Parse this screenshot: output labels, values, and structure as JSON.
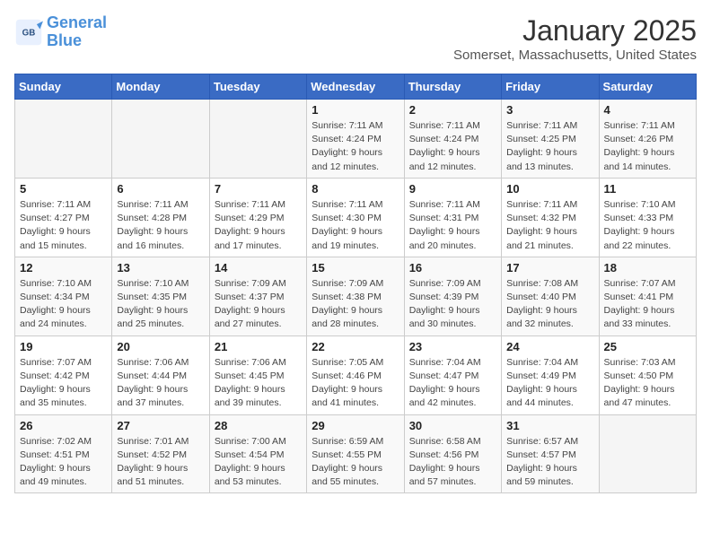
{
  "header": {
    "logo_line1": "General",
    "logo_line2": "Blue",
    "month_title": "January 2025",
    "location": "Somerset, Massachusetts, United States"
  },
  "weekdays": [
    "Sunday",
    "Monday",
    "Tuesday",
    "Wednesday",
    "Thursday",
    "Friday",
    "Saturday"
  ],
  "weeks": [
    [
      {
        "day": "",
        "info": ""
      },
      {
        "day": "",
        "info": ""
      },
      {
        "day": "",
        "info": ""
      },
      {
        "day": "1",
        "info": "Sunrise: 7:11 AM\nSunset: 4:24 PM\nDaylight: 9 hours\nand 12 minutes."
      },
      {
        "day": "2",
        "info": "Sunrise: 7:11 AM\nSunset: 4:24 PM\nDaylight: 9 hours\nand 12 minutes."
      },
      {
        "day": "3",
        "info": "Sunrise: 7:11 AM\nSunset: 4:25 PM\nDaylight: 9 hours\nand 13 minutes."
      },
      {
        "day": "4",
        "info": "Sunrise: 7:11 AM\nSunset: 4:26 PM\nDaylight: 9 hours\nand 14 minutes."
      }
    ],
    [
      {
        "day": "5",
        "info": "Sunrise: 7:11 AM\nSunset: 4:27 PM\nDaylight: 9 hours\nand 15 minutes."
      },
      {
        "day": "6",
        "info": "Sunrise: 7:11 AM\nSunset: 4:28 PM\nDaylight: 9 hours\nand 16 minutes."
      },
      {
        "day": "7",
        "info": "Sunrise: 7:11 AM\nSunset: 4:29 PM\nDaylight: 9 hours\nand 17 minutes."
      },
      {
        "day": "8",
        "info": "Sunrise: 7:11 AM\nSunset: 4:30 PM\nDaylight: 9 hours\nand 19 minutes."
      },
      {
        "day": "9",
        "info": "Sunrise: 7:11 AM\nSunset: 4:31 PM\nDaylight: 9 hours\nand 20 minutes."
      },
      {
        "day": "10",
        "info": "Sunrise: 7:11 AM\nSunset: 4:32 PM\nDaylight: 9 hours\nand 21 minutes."
      },
      {
        "day": "11",
        "info": "Sunrise: 7:10 AM\nSunset: 4:33 PM\nDaylight: 9 hours\nand 22 minutes."
      }
    ],
    [
      {
        "day": "12",
        "info": "Sunrise: 7:10 AM\nSunset: 4:34 PM\nDaylight: 9 hours\nand 24 minutes."
      },
      {
        "day": "13",
        "info": "Sunrise: 7:10 AM\nSunset: 4:35 PM\nDaylight: 9 hours\nand 25 minutes."
      },
      {
        "day": "14",
        "info": "Sunrise: 7:09 AM\nSunset: 4:37 PM\nDaylight: 9 hours\nand 27 minutes."
      },
      {
        "day": "15",
        "info": "Sunrise: 7:09 AM\nSunset: 4:38 PM\nDaylight: 9 hours\nand 28 minutes."
      },
      {
        "day": "16",
        "info": "Sunrise: 7:09 AM\nSunset: 4:39 PM\nDaylight: 9 hours\nand 30 minutes."
      },
      {
        "day": "17",
        "info": "Sunrise: 7:08 AM\nSunset: 4:40 PM\nDaylight: 9 hours\nand 32 minutes."
      },
      {
        "day": "18",
        "info": "Sunrise: 7:07 AM\nSunset: 4:41 PM\nDaylight: 9 hours\nand 33 minutes."
      }
    ],
    [
      {
        "day": "19",
        "info": "Sunrise: 7:07 AM\nSunset: 4:42 PM\nDaylight: 9 hours\nand 35 minutes."
      },
      {
        "day": "20",
        "info": "Sunrise: 7:06 AM\nSunset: 4:44 PM\nDaylight: 9 hours\nand 37 minutes."
      },
      {
        "day": "21",
        "info": "Sunrise: 7:06 AM\nSunset: 4:45 PM\nDaylight: 9 hours\nand 39 minutes."
      },
      {
        "day": "22",
        "info": "Sunrise: 7:05 AM\nSunset: 4:46 PM\nDaylight: 9 hours\nand 41 minutes."
      },
      {
        "day": "23",
        "info": "Sunrise: 7:04 AM\nSunset: 4:47 PM\nDaylight: 9 hours\nand 42 minutes."
      },
      {
        "day": "24",
        "info": "Sunrise: 7:04 AM\nSunset: 4:49 PM\nDaylight: 9 hours\nand 44 minutes."
      },
      {
        "day": "25",
        "info": "Sunrise: 7:03 AM\nSunset: 4:50 PM\nDaylight: 9 hours\nand 47 minutes."
      }
    ],
    [
      {
        "day": "26",
        "info": "Sunrise: 7:02 AM\nSunset: 4:51 PM\nDaylight: 9 hours\nand 49 minutes."
      },
      {
        "day": "27",
        "info": "Sunrise: 7:01 AM\nSunset: 4:52 PM\nDaylight: 9 hours\nand 51 minutes."
      },
      {
        "day": "28",
        "info": "Sunrise: 7:00 AM\nSunset: 4:54 PM\nDaylight: 9 hours\nand 53 minutes."
      },
      {
        "day": "29",
        "info": "Sunrise: 6:59 AM\nSunset: 4:55 PM\nDaylight: 9 hours\nand 55 minutes."
      },
      {
        "day": "30",
        "info": "Sunrise: 6:58 AM\nSunset: 4:56 PM\nDaylight: 9 hours\nand 57 minutes."
      },
      {
        "day": "31",
        "info": "Sunrise: 6:57 AM\nSunset: 4:57 PM\nDaylight: 9 hours\nand 59 minutes."
      },
      {
        "day": "",
        "info": ""
      }
    ]
  ]
}
